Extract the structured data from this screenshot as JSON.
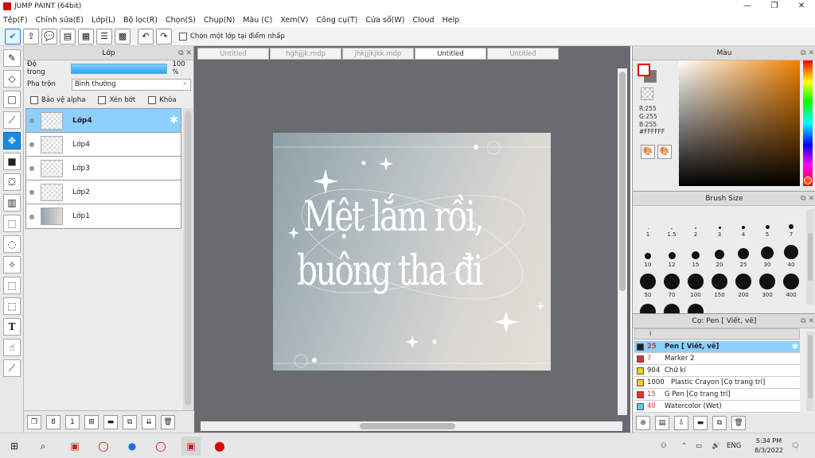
{
  "window": {
    "title": "JUMP PAINT (64bit)"
  },
  "menu": [
    "Tệp(F)",
    "Chỉnh sửa(E)",
    "Lớp(L)",
    "Bộ lọc(R)",
    "Chọn(S)",
    "Chụp(N)",
    "Màu (C)",
    "Xem(V)",
    "Công cụ(T)",
    "Cửa sổ(W)",
    "Cloud",
    "Help"
  ],
  "toolbar": {
    "pick_layer_label": "Chọn một lớp tại điểm nhấp"
  },
  "layer_panel": {
    "title": "Lớp",
    "opacity_label": "Độ trong",
    "opacity_value": "100 %",
    "opacity_fraction": 1.0,
    "blend_label": "Pha trộn",
    "blend_value": "Bình thường",
    "protect_alpha": "Bảo vệ alpha",
    "clipping": "Xén bớt",
    "lock": "Khóa",
    "layers": [
      "Lớp4",
      "Lớp4",
      "Lớp3",
      "Lớp2",
      "Lớp1"
    ]
  },
  "canvas": {
    "tabs": [
      "Untitled",
      "hghjjjk.mdp",
      "jhkjjjkjkk.mdp",
      "Untitled",
      "Untitled"
    ],
    "active_tab": 3,
    "text_line1": "Mệt lắm rồi,",
    "text_line2": "buông tha đi"
  },
  "color_panel": {
    "title": "Màu",
    "r": "R:255",
    "g": "G:255",
    "b": "B:255",
    "hex": "#FFFFFF",
    "foreground": "#ffffff"
  },
  "brush_size": {
    "title": "Brush Size",
    "sizes": [
      "1",
      "1.5",
      "2",
      "3",
      "4",
      "5",
      "7",
      "10",
      "12",
      "15",
      "20",
      "25",
      "30",
      "40",
      "50",
      "70",
      "100",
      "150",
      "200",
      "300",
      "400",
      "",
      "",
      ""
    ]
  },
  "brush_list": {
    "title": "Cọ: Pen [ Viết, vẽ]",
    "items": [
      {
        "size": "25",
        "name": "Pen [ Viết, vẽ]",
        "color": "#222222"
      },
      {
        "size": "7",
        "name": "Marker 2",
        "color": "#e03030"
      },
      {
        "size": "904",
        "name": "Chữ kí",
        "color": "#f0d020"
      },
      {
        "size": "1000",
        "name": "Plastic Crayon [Cọ trang trí]",
        "color": "#f0d020"
      },
      {
        "size": "15",
        "name": "G Pen [Cọ trang trí]",
        "color": "#e03030"
      },
      {
        "size": "40",
        "name": "Watercolor (Wet)",
        "color": "#60c8f0"
      }
    ]
  },
  "taskbar": {
    "lang": "ENG",
    "time": "5:34 PM",
    "date": "8/3/2022"
  }
}
